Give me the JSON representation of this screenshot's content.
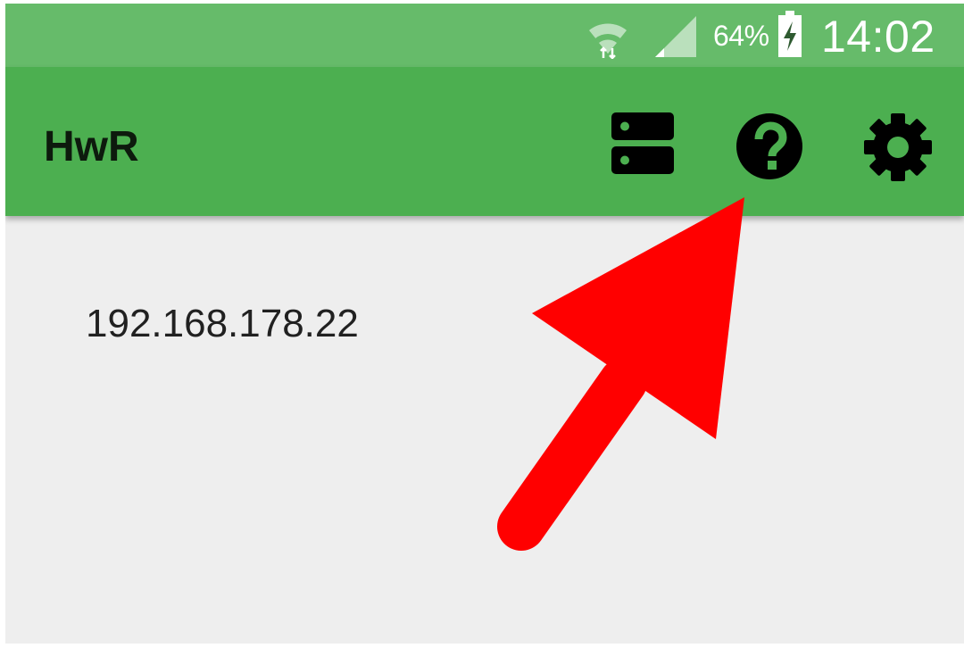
{
  "status_bar": {
    "battery_percent": "64%",
    "time": "14:02",
    "icons": [
      "wifi-icon",
      "signal-icon",
      "battery-charging-icon"
    ]
  },
  "app_bar": {
    "title": "HwR",
    "actions": [
      {
        "name": "servers-icon"
      },
      {
        "name": "help-icon"
      },
      {
        "name": "settings-icon"
      }
    ]
  },
  "content": {
    "items": [
      "192.168.178.22"
    ]
  },
  "colors": {
    "status_bar": "#66bb6a",
    "app_bar": "#4caf50",
    "background": "#eeeeee",
    "annotation_arrow": "#ff0000"
  }
}
